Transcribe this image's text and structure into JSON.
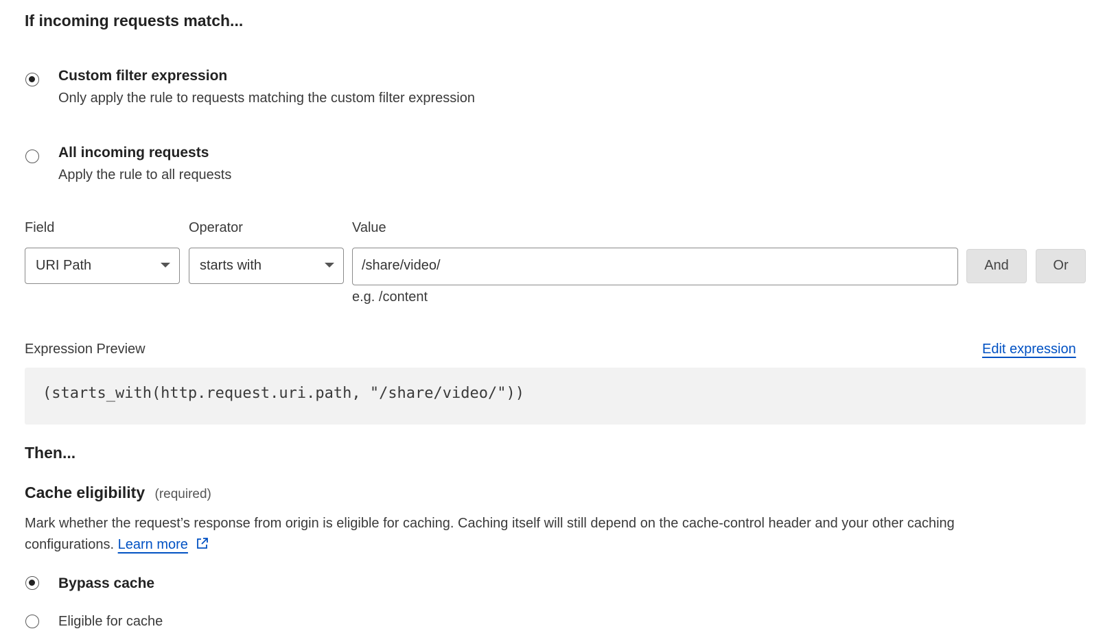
{
  "match_section": {
    "title": "If incoming requests match...",
    "options": [
      {
        "title": "Custom filter expression",
        "description": "Only apply the rule to requests matching the custom filter expression",
        "selected": true
      },
      {
        "title": "All incoming requests",
        "description": "Apply the rule to all requests",
        "selected": false
      }
    ]
  },
  "filter": {
    "field_label": "Field",
    "field_value": "URI Path",
    "operator_label": "Operator",
    "operator_value": "starts with",
    "value_label": "Value",
    "value_value": "/share/video/",
    "value_hint": "e.g. /content",
    "and_label": "And",
    "or_label": "Or"
  },
  "preview": {
    "label": "Expression Preview",
    "edit_link": "Edit expression",
    "expression": "(starts_with(http.request.uri.path, \"/share/video/\"))"
  },
  "then_section": {
    "title": "Then..."
  },
  "cache": {
    "title": "Cache eligibility",
    "required": "(required)",
    "description": "Mark whether the request’s response from origin is eligible for caching. Caching itself will still depend on the cache-control header and your other caching",
    "description_cont": "configurations.",
    "learn_more": "Learn more",
    "options": [
      {
        "label": "Bypass cache",
        "selected": true
      },
      {
        "label": "Eligible for cache",
        "selected": false
      }
    ]
  },
  "icons": {
    "external_link": "external-link-icon",
    "dropdown": "chevron-down-icon"
  },
  "colors": {
    "link": "#0051c3",
    "button_bg": "#e3e3e3",
    "preview_bg": "#f2f2f2"
  }
}
